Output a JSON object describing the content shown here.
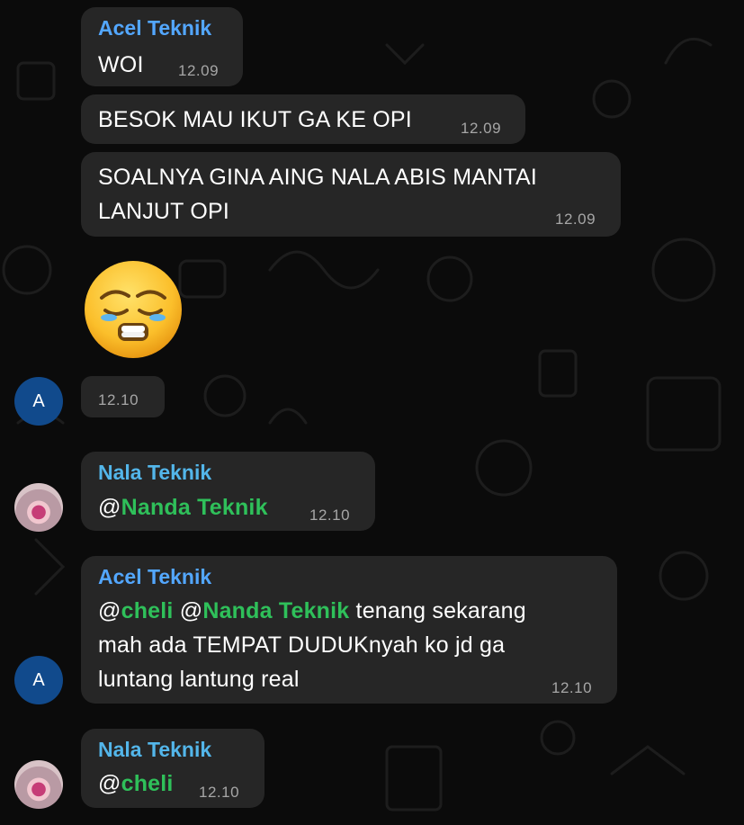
{
  "colors": {
    "background": "#0b0b0b",
    "bubble": "#262626",
    "sender_acel": "#53a7ff",
    "sender_nala": "#53b6ea",
    "mention": "#2fc05a",
    "timestamp": "#a6a6a6",
    "avatar_letter_bg": "#114a8c"
  },
  "messages": [
    {
      "sender": "Acel Teknik",
      "text": "WOI",
      "time": "12.09"
    },
    {
      "text": "BESOK MAU IKUT GA KE OPI",
      "time": "12.09"
    },
    {
      "lines": [
        "SOALNYA GINA AING NALA ABIS MANTAI",
        "LANJUT OPI"
      ],
      "time": "12.09"
    },
    {
      "emoji": "tired-face-emoji",
      "time": "12.10",
      "avatar_letter": "A"
    },
    {
      "sender": "Nala Teknik",
      "at": "@",
      "mention": "Nanda Teknik",
      "time": "12.10"
    },
    {
      "sender": "Acel Teknik",
      "at1": "@",
      "mention1": "cheli",
      "at2": " @",
      "mention2": "Nanda Teknik",
      "rest_line1": " tenang sekarang",
      "line2": "mah ada TEMPAT DUDUKnyah ko jd ga",
      "line3": "luntang lantung real",
      "time": "12.10",
      "avatar_letter": "A"
    },
    {
      "sender": "Nala Teknik",
      "at": "@",
      "mention": "cheli",
      "time": "12.10"
    }
  ]
}
